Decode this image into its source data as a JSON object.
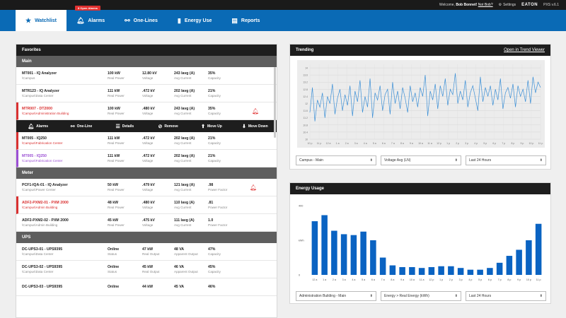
{
  "topbar": {
    "welcome": "Welcome,",
    "user": "Bob Bonnet!",
    "not_you": "Not Bob?",
    "settings": "Settings",
    "brand": "EATON",
    "product": "PXS v.6.1"
  },
  "nav": {
    "items": [
      {
        "label": "Watchlist",
        "icon": "star-icon"
      },
      {
        "label": "Alarms",
        "icon": "bell-icon",
        "badge": "8 Open Alarms"
      },
      {
        "label": "One-Lines",
        "icon": "one-line-icon"
      },
      {
        "label": "Energy Use",
        "icon": "bar-chart-icon"
      },
      {
        "label": "Reports",
        "icon": "report-icon"
      }
    ]
  },
  "favorites": {
    "title": "Favorites",
    "sections": [
      {
        "name": "Main",
        "rows": [
          {
            "name": "MT001 - IQ Analyzer",
            "path": "\\Campus",
            "v1": "100 kW",
            "l1": "Real Power",
            "v2": "12.80 kV",
            "l2": "Voltage",
            "v3": "243 Iavg (A)",
            "l3": "Avg Current",
            "v4": "35%",
            "l4": "Capacity",
            "style": ""
          },
          {
            "name": "MTR123 - IQ Analyzer",
            "path": "\\Campus\\Data Center",
            "v1": "111 kW",
            "l1": "Real Power",
            "v2": ".472 kV",
            "l2": "Voltage",
            "v3": "202 Iavg (A)",
            "l3": "Avg Current",
            "v4": "21%",
            "l4": "Capacity",
            "style": ""
          },
          {
            "name": "MTR007 - DT2000",
            "path": "\\Campus\\Administration Building",
            "v1": "100 kW",
            "l1": "Real Power",
            "v2": ".480 kV",
            "l2": "Voltage",
            "v3": "243 Iavg (A)",
            "l3": "Avg Current",
            "v4": "35%",
            "l4": "Capacity",
            "style": "alarm",
            "bell": true
          },
          {
            "name": "MT005 - IQ250",
            "path": "\\Campus\\Fabrication Center",
            "v1": "111 kW",
            "l1": "Real Power",
            "v2": ".472 kV",
            "l2": "Voltage",
            "v3": "202 Iavg (A)",
            "l3": "Avg Current",
            "v4": "21%",
            "l4": "Capacity",
            "style": "alarm alarm-ok"
          },
          {
            "name": "MT005 - IQ250",
            "path": "\\Campus\\Fabrication Center",
            "v1": "111 kW",
            "l1": "Real Power",
            "v2": ".472 kV",
            "l2": "Voltage",
            "v3": "202 Iavg (A)",
            "l3": "Avg Current",
            "v4": "21%",
            "l4": "Capacity",
            "style": "purple"
          }
        ]
      },
      {
        "name": "Meter",
        "rows": [
          {
            "name": "PCF1-IQA-01 - IQ Analyzer",
            "path": "\\Campus\\Power Center",
            "v1": "50 kW",
            "l1": "Real Power",
            "v2": ".479 kV",
            "l2": "Voltage",
            "v3": "121 Iavg (A)",
            "l3": "Avg Current",
            "v4": ".98",
            "l4": "Power Factor",
            "style": "",
            "bell": true
          },
          {
            "name": "ADF2-PXM2-01 - PXM 2000",
            "path": "\\Campus\\Admin Building",
            "v1": "48 kW",
            "l1": "Real Power",
            "v2": ".480 kV",
            "l2": "Voltage",
            "v3": "110 Iavg (A)",
            "l3": "Avg Current",
            "v4": ".81",
            "l4": "Power Factor",
            "style": "alarm"
          },
          {
            "name": "ADF2-PXM2-02 - PXM 2000",
            "path": "\\Campus\\Admin Building",
            "v1": "45 kW",
            "l1": "Real Power",
            "v2": ".475 kV",
            "l2": "Voltage",
            "v3": "111 Iavg (A)",
            "l3": "Avg Current",
            "v4": "1.0",
            "l4": "Power Factor",
            "style": ""
          }
        ]
      },
      {
        "name": "UPS",
        "rows": [
          {
            "name": "DC-UPS3-01 - UPS9395",
            "path": "\\Campus\\Data Center",
            "v1": "Online",
            "l1": "Status",
            "v2": "47 kW",
            "l2": "Real Output",
            "v3": "48 VA",
            "l3": "Apparent Output",
            "v4": "47%",
            "l4": "Capacity",
            "style": ""
          },
          {
            "name": "DC-UPS3-02 - UPS9395",
            "path": "\\Campus\\Data Center",
            "v1": "Online",
            "l1": "Status",
            "v2": "45 kW",
            "l2": "Real Output",
            "v3": "46 VA",
            "l3": "Apparent Output",
            "v4": "45%",
            "l4": "Capacity",
            "style": ""
          },
          {
            "name": "DC-UPS3-03 - UPS9395",
            "path": "",
            "v1": "Online",
            "l1": "",
            "v2": "44 kW",
            "l2": "",
            "v3": "45 VA",
            "l3": "",
            "v4": "46%",
            "l4": "",
            "style": ""
          }
        ]
      }
    ],
    "actions": [
      {
        "label": "Alarms",
        "icon": "bell-icon"
      },
      {
        "label": "One-Line",
        "icon": "one-line-icon"
      },
      {
        "label": "Details",
        "icon": "details-icon"
      },
      {
        "label": "Remove",
        "icon": "remove-icon"
      },
      {
        "label": "Move Up",
        "icon": "arrow-up-icon"
      },
      {
        "label": "Move Down",
        "icon": "arrow-down-icon"
      }
    ]
  },
  "trending": {
    "title": "Trending",
    "link": "Open in Trend Viewer",
    "selects": [
      "Campus - Main",
      "Voltage Avg (LN)",
      "Last 24 Hours"
    ]
  },
  "energy": {
    "title": "Energy Usage",
    "selects": [
      "Administration Building - Main",
      "Energy > Real Energy (kWh)",
      "Last 24 Hours"
    ]
  },
  "chart_data": [
    {
      "type": "line",
      "title": "Trending",
      "x": [
        "10 p",
        "11 p",
        "12 a",
        "1 a",
        "2 a",
        "3 a",
        "4 a",
        "5 a",
        "6 a",
        "7 a",
        "8 a",
        "9 a",
        "10 a",
        "11 a",
        "12 p",
        "1 p",
        "2 p",
        "3 p",
        "4 p",
        "5 p",
        "6 p",
        "7 p",
        "8 p",
        "9 p",
        "10 p",
        "11 p"
      ],
      "yticks": [
        "14",
        "13.6",
        "13.2",
        "12.8",
        "12.4",
        "12",
        "11.6",
        "11.2",
        "10.8",
        "10.4",
        "10"
      ],
      "ylim": [
        10,
        14.2
      ],
      "values": [
        11.5,
        12.9,
        11.0,
        12.2,
        11.8,
        12.6,
        11.2,
        12.4,
        12.0,
        13.1,
        11.4,
        12.3,
        12.8,
        11.6,
        12.5,
        11.9,
        13.0,
        11.3,
        12.7,
        12.1,
        13.3,
        11.5,
        12.4,
        11.8,
        13.4,
        11.2,
        12.6,
        12.2,
        13.0,
        11.6,
        12.5,
        12.8,
        11.4,
        13.2,
        12.0,
        12.7,
        11.7,
        12.9,
        12.3,
        11.5,
        13.0,
        12.1,
        12.6,
        11.8,
        12.9,
        12.4,
        13.6,
        11.3,
        12.7,
        12.2,
        13.1,
        11.7,
        13.0,
        12.4,
        13.4,
        11.9,
        12.8,
        12.5,
        13.7,
        12.0,
        12.7,
        12.2,
        13.3,
        11.8,
        12.6,
        13.0,
        12.3,
        11.6,
        13.5,
        12.1,
        12.9,
        12.4,
        13.0,
        11.9,
        12.8,
        12.2,
        13.4,
        11.7,
        12.6,
        12.9,
        12.3,
        13.1,
        11.8,
        13.0,
        12.4,
        12.8,
        12.1,
        13.3,
        12.0,
        13.5,
        12.6,
        13.2,
        12.9
      ]
    },
    {
      "type": "bar",
      "title": "Energy Usage",
      "categories": [
        "12 a",
        "1 a",
        "2 a",
        "3 a",
        "4 a",
        "5 a",
        "6 a",
        "7 a",
        "8 a",
        "9 a",
        "10 a",
        "11 a",
        "12 p",
        "1 p",
        "2 p",
        "3 p",
        "4 p",
        "5 p",
        "6 p",
        "7 p",
        "8 p",
        "9 p",
        "10 p",
        "11 p"
      ],
      "values": [
        310,
        345,
        255,
        235,
        230,
        250,
        200,
        100,
        55,
        45,
        45,
        40,
        45,
        50,
        50,
        40,
        30,
        30,
        40,
        70,
        110,
        145,
        200,
        295
      ],
      "ylabel": "kWh",
      "yticks": [
        "400",
        "kWh",
        "0"
      ],
      "ylim": [
        0,
        400
      ]
    }
  ]
}
